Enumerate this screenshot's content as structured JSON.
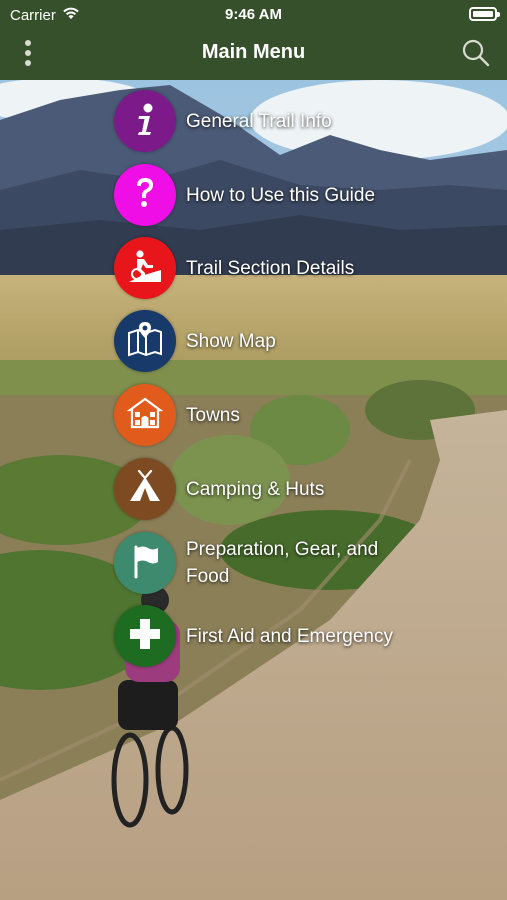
{
  "status_bar": {
    "carrier": "Carrier",
    "time": "9:46 AM"
  },
  "nav": {
    "title": "Main Menu"
  },
  "menu_items": [
    {
      "label": "General Trail Info",
      "color": "#7d1a8a",
      "icon": "info-icon"
    },
    {
      "label": "How to Use this Guide",
      "color": "#f00ee6",
      "icon": "question-icon"
    },
    {
      "label": "Trail Section Details",
      "color": "#e8161a",
      "icon": "cyclist-icon"
    },
    {
      "label": "Show Map",
      "color": "#173a6b",
      "icon": "map-icon"
    },
    {
      "label": "Towns",
      "color": "#e05b1c",
      "icon": "building-icon"
    },
    {
      "label": "Camping & Huts",
      "color": "#7e4a22",
      "icon": "tent-icon"
    },
    {
      "label": "Preparation, Gear, and Food",
      "color": "#3e8a6f",
      "icon": "flag-icon"
    },
    {
      "label": "First Aid and Emergency",
      "color": "#1e6b22",
      "icon": "first-aid-icon"
    }
  ]
}
